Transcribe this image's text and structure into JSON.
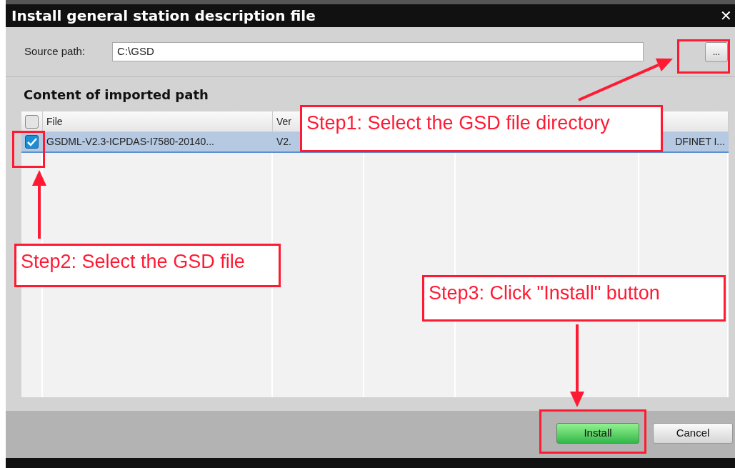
{
  "window": {
    "title": "Install general station description file",
    "close": "✕"
  },
  "source": {
    "label": "Source path:",
    "value": "C:\\GSD",
    "browse": "..."
  },
  "section_title": "Content of imported path",
  "table": {
    "select_all_checked": false,
    "columns": [
      "File",
      "Ver"
    ],
    "rows": [
      {
        "selected": true,
        "checked": true,
        "cells": [
          "GSDML-V2.3-ICPDAS-I7580-20140...",
          "V2.",
          "",
          "",
          "DFINET I..."
        ]
      }
    ]
  },
  "buttons": [
    {
      "label": "Install",
      "kind": "primary"
    },
    {
      "label": "Cancel",
      "kind": "secondary"
    }
  ],
  "callouts": [
    {
      "text": "Step1: Select the GSD file directory"
    },
    {
      "text": "Step2: Select the GSD file"
    },
    {
      "text": "Step3: Click \"Install\" button"
    }
  ]
}
